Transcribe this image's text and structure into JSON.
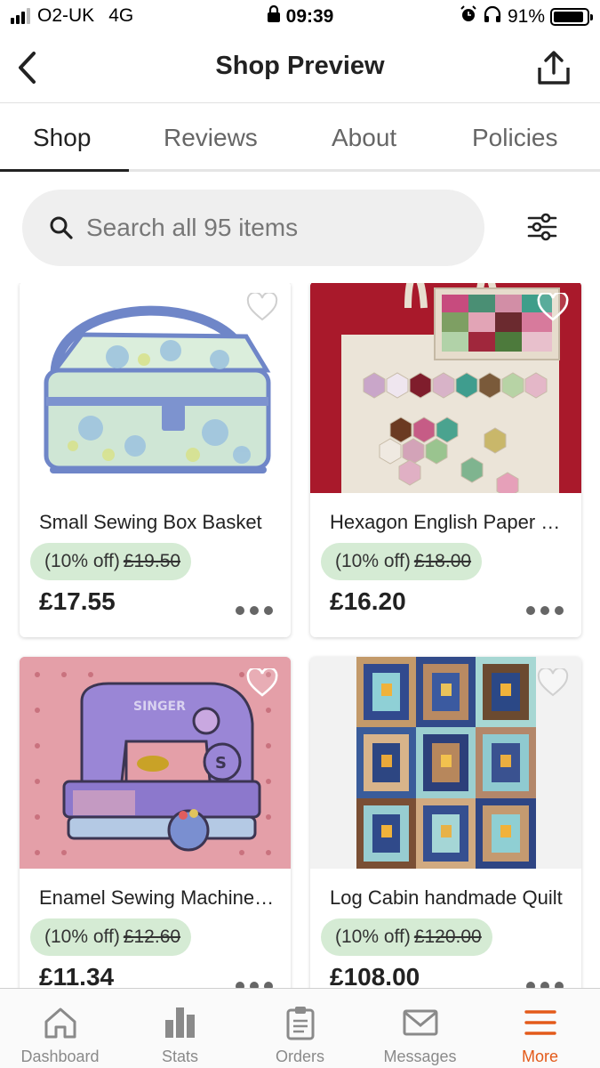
{
  "status_bar": {
    "carrier": "O2-UK",
    "network": "4G",
    "time": "09:39",
    "battery": "91%",
    "battery_level": 0.91
  },
  "header": {
    "title": "Shop Preview",
    "back_icon": "chevron-left-icon",
    "share_icon": "share-icon"
  },
  "tabs": [
    {
      "label": "Shop",
      "active": true
    },
    {
      "label": "Reviews",
      "active": false
    },
    {
      "label": "About",
      "active": false
    },
    {
      "label": "Policies",
      "active": false
    }
  ],
  "search": {
    "placeholder": "Search all 95 items",
    "filter_icon": "sliders-icon"
  },
  "listings": [
    {
      "title": "Small Sewing Box  Basket",
      "discount": "(10% off)",
      "original_price": "£19.50",
      "price": "£17.55",
      "favorited": false
    },
    {
      "title": "Hexagon English Paper Piecing Bag",
      "discount": "(10% off)",
      "original_price": "£18.00",
      "price": "£16.20",
      "favorited": false
    },
    {
      "title": "Enamel Sewing Machine Pin",
      "discount": "(10% off)",
      "original_price": "£12.60",
      "price": "£11.34",
      "favorited": false
    },
    {
      "title": "Log Cabin handmade Quilt",
      "discount": "(10% off)",
      "original_price": "£120.00",
      "price": "£108.00",
      "favorited": false
    }
  ],
  "colors": {
    "accent": "#e35a1a",
    "discount_bg": "#d5ebd4",
    "nav_inactive": "#8a8a8a"
  },
  "bottom_nav": [
    {
      "label": "Dashboard",
      "icon": "home-icon",
      "active": false
    },
    {
      "label": "Stats",
      "icon": "bar-chart-icon",
      "active": false
    },
    {
      "label": "Orders",
      "icon": "clipboard-icon",
      "active": false
    },
    {
      "label": "Messages",
      "icon": "envelope-icon",
      "active": false
    },
    {
      "label": "More",
      "icon": "menu-icon",
      "active": true
    }
  ]
}
